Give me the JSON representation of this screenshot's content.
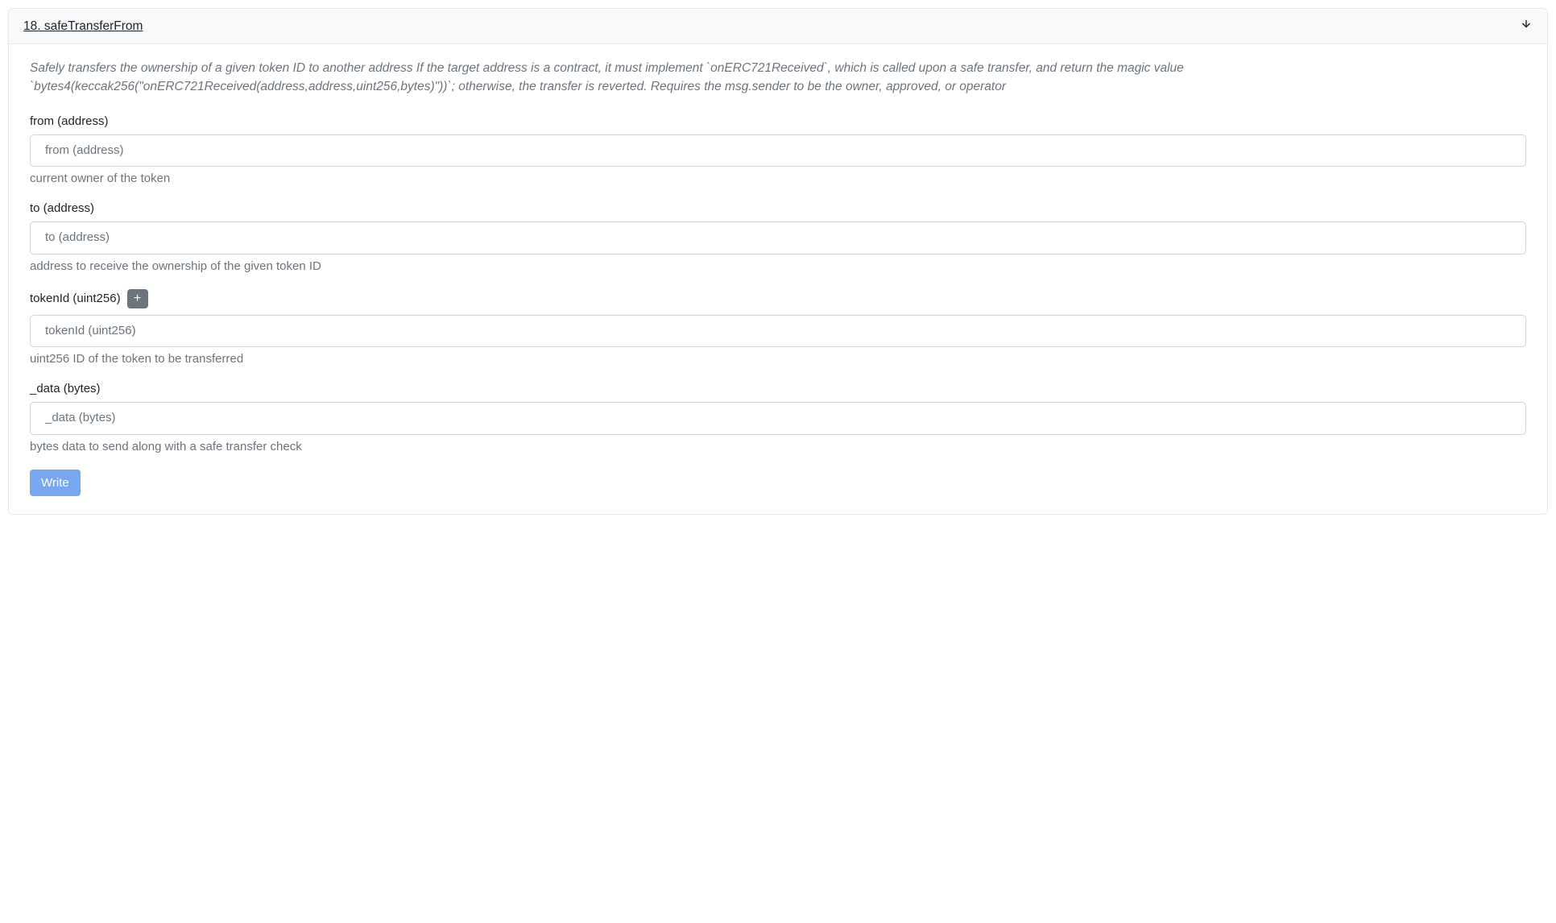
{
  "function": {
    "title": "18. safeTransferFrom",
    "description": "Safely transfers the ownership of a given token ID to another address If the target address is a contract, it must implement `onERC721Received`, which is called upon a safe transfer, and return the magic value `bytes4(keccak256(\"onERC721Received(address,address,uint256,bytes)\"))`; otherwise, the transfer is reverted. Requires the msg.sender to be the owner, approved, or operator",
    "fields": {
      "from": {
        "label": "from (address)",
        "placeholder": "from (address)",
        "help": "current owner of the token",
        "has_plus": false
      },
      "to": {
        "label": "to (address)",
        "placeholder": "to (address)",
        "help": "address to receive the ownership of the given token ID",
        "has_plus": false
      },
      "tokenId": {
        "label": "tokenId (uint256)",
        "placeholder": "tokenId (uint256)",
        "help": "uint256 ID of the token to be transferred",
        "has_plus": true
      },
      "data": {
        "label": "_data (bytes)",
        "placeholder": "_data (bytes)",
        "help": "bytes data to send along with a safe transfer check",
        "has_plus": false
      }
    },
    "submit_label": "Write",
    "plus_icon": "+"
  }
}
